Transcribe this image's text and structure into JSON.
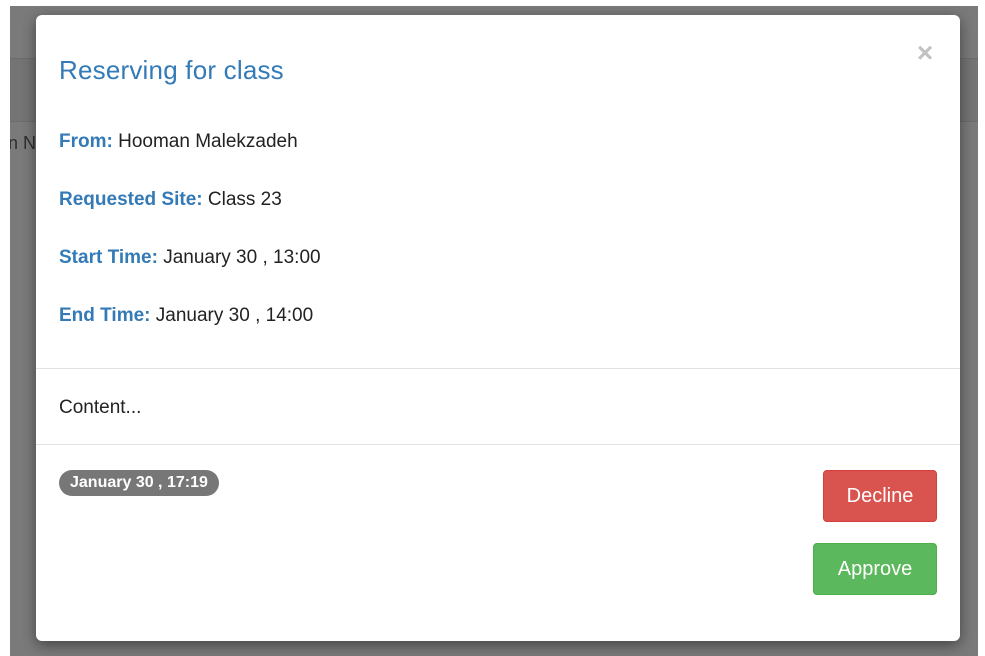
{
  "background": {
    "partial_text": "an N"
  },
  "modal": {
    "title": "Reserving for class",
    "close_label": "×",
    "fields": {
      "from": {
        "label": "From:",
        "value": "Hooman Malekzadeh"
      },
      "site": {
        "label": "Requested Site:",
        "value": "Class 23"
      },
      "start": {
        "label": "Start Time:",
        "value": "January 30 , 13:00"
      },
      "end": {
        "label": "End Time:",
        "value": "January 30 , 14:00"
      }
    },
    "content": "Content...",
    "timestamp": "January 30 , 17:19",
    "decline_label": "Decline",
    "approve_label": "Approve"
  },
  "colors": {
    "accent": "#337ab7",
    "decline": "#d9534f",
    "approve": "#5cb85c",
    "badge": "#777777",
    "backdrop": "#7a7a7a"
  }
}
